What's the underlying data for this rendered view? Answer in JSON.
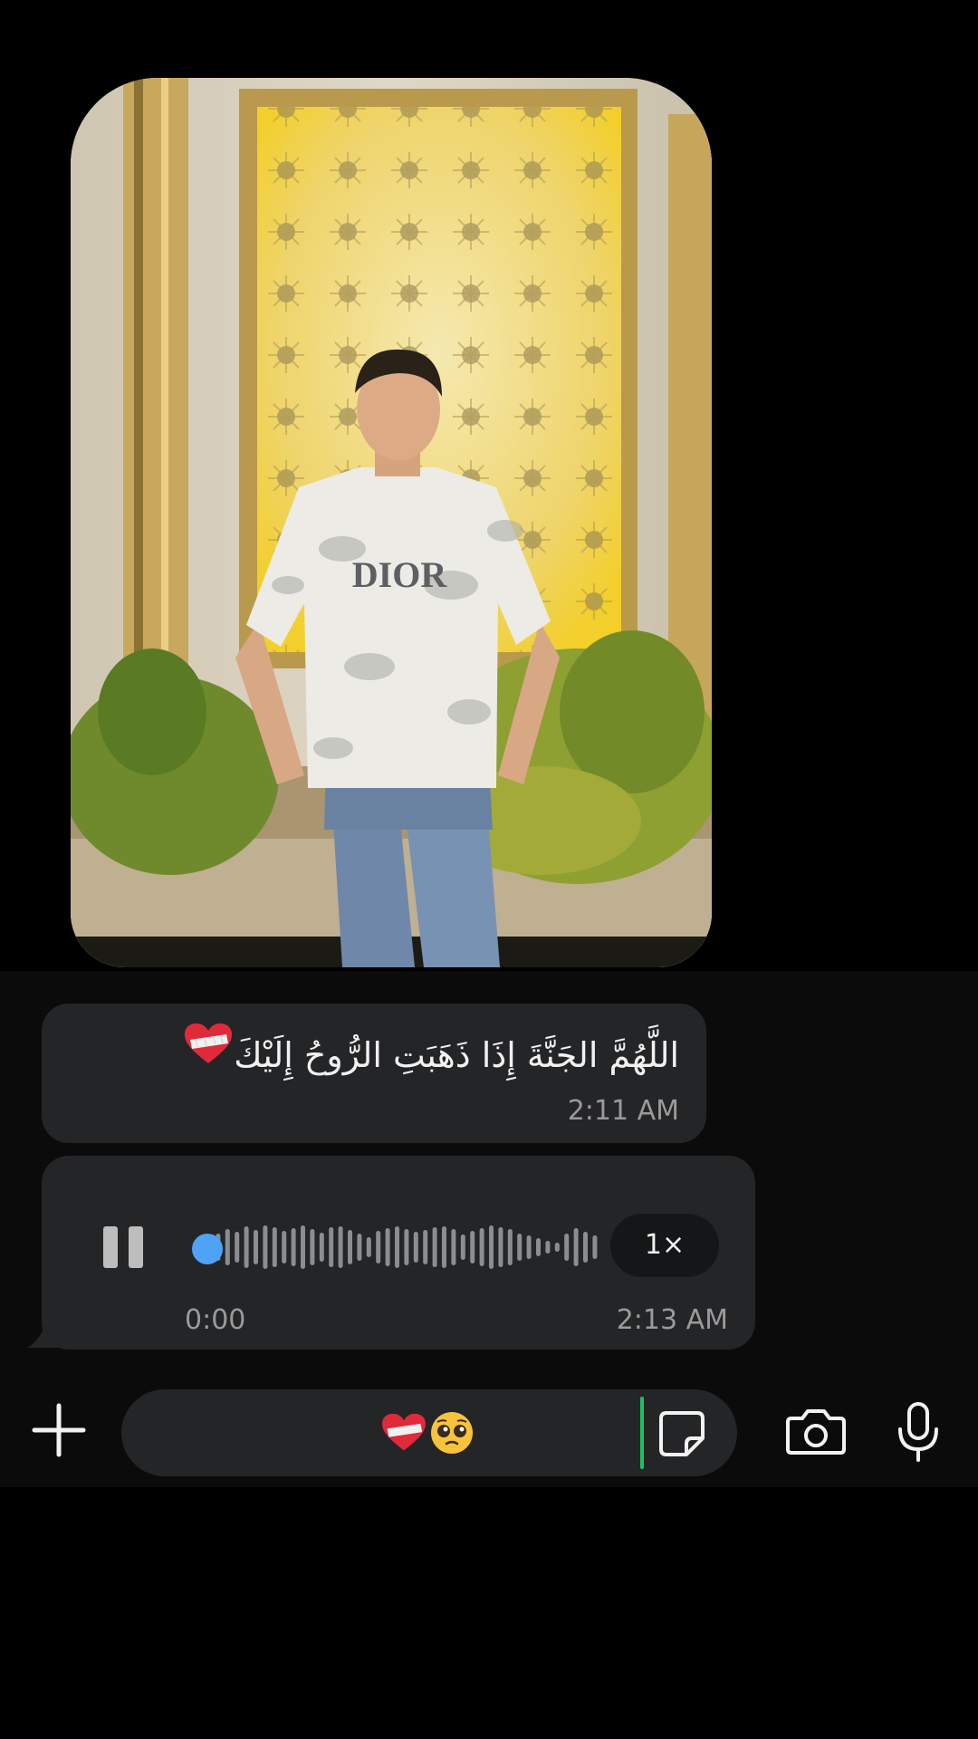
{
  "photo": {
    "shirt_text": "DIOR"
  },
  "messages": {
    "text_message": {
      "text": "اللَّهُمَّ الجَنَّةَ إِذَا ذَهَبَتِ الرُّوحُ إِلَيْكَ",
      "emoji": "mending-heart",
      "time": "2:11 AM"
    },
    "voice_message": {
      "duration": "0:00",
      "speed": "1×",
      "time": "2:13 AM",
      "progress": 0,
      "state": "playing"
    }
  },
  "input_bar": {
    "draft_emojis": [
      "mending-heart",
      "pleading-face"
    ],
    "icons": {
      "attach": "plus-icon",
      "sticker": "sticker-icon",
      "camera": "camera-icon",
      "mic": "microphone-icon"
    }
  },
  "colors": {
    "bubble": "#242527",
    "accent_blue": "#4fa3f7",
    "cursor_green": "#21c063",
    "background": "#000000"
  }
}
